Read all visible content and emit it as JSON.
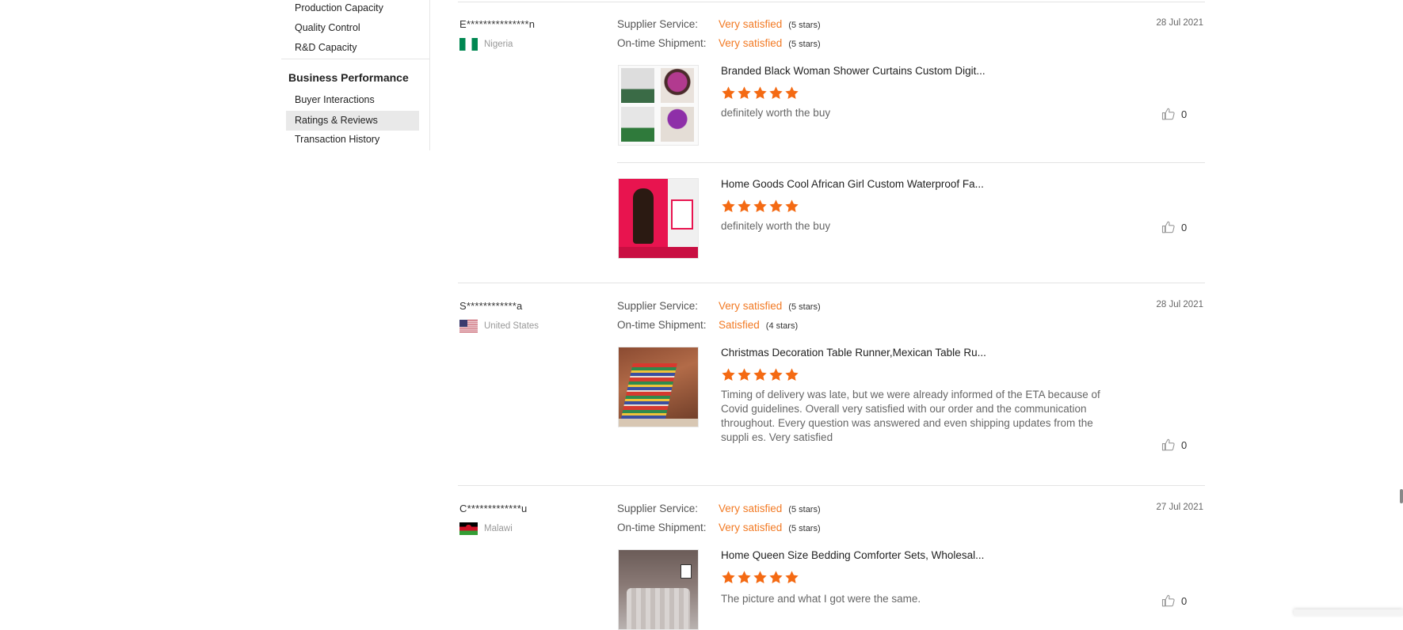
{
  "sidebar": {
    "items_top": [
      {
        "label": "Production Capacity"
      },
      {
        "label": "Quality Control"
      },
      {
        "label": "R&D Capacity"
      }
    ],
    "heading": "Business Performance",
    "items_bottom": [
      {
        "label": "Buyer Interactions"
      },
      {
        "label": "Ratings & Reviews",
        "active": true
      },
      {
        "label": "Transaction History"
      }
    ]
  },
  "labels": {
    "supplier_service": "Supplier Service:",
    "ontime_shipment": "On-time Shipment:"
  },
  "colors": {
    "accent": "#f27a24",
    "star": "#f46a13"
  },
  "reviews": [
    {
      "name": "E***************n",
      "country": "Nigeria",
      "date": "28 Jul 2021",
      "supplier_service": {
        "value": "Very satisfied",
        "stars_note": "(5 stars)"
      },
      "ontime_shipment": {
        "value": "Very satisfied",
        "stars_note": "(5 stars)"
      },
      "products": [
        {
          "title": "Branded Black Woman Shower Curtains Custom Digit...",
          "rating": 5,
          "text": "definitely worth the buy",
          "likes": "0"
        },
        {
          "title": "Home Goods Cool African Girl Custom Waterproof Fa...",
          "rating": 5,
          "text": "definitely worth the buy",
          "likes": "0"
        }
      ]
    },
    {
      "name": "S************a",
      "country": "United States",
      "date": "28 Jul 2021",
      "supplier_service": {
        "value": "Very satisfied",
        "stars_note": "(5 stars)"
      },
      "ontime_shipment": {
        "value": "Satisfied",
        "stars_note": "(4 stars)"
      },
      "products": [
        {
          "title": "Christmas Decoration Table Runner,Mexican Table Ru...",
          "rating": 5,
          "text": "Timing of delivery was late, but we were already informed of the ETA because of Covid guidelines. Overall very satisfied with our order and the communication throughout. Every question was answered and even shipping updates from the suppli es. Very satisfied",
          "likes": "0"
        }
      ]
    },
    {
      "name": "C*************u",
      "country": "Malawi",
      "date": "27 Jul 2021",
      "supplier_service": {
        "value": "Very satisfied",
        "stars_note": "(5 stars)"
      },
      "ontime_shipment": {
        "value": "Very satisfied",
        "stars_note": "(5 stars)"
      },
      "products": [
        {
          "title": "Home Queen Size Bedding Comforter Sets, Wholesal...",
          "rating": 5,
          "text": "The picture and what I got were the same.",
          "likes": "0"
        }
      ]
    }
  ]
}
